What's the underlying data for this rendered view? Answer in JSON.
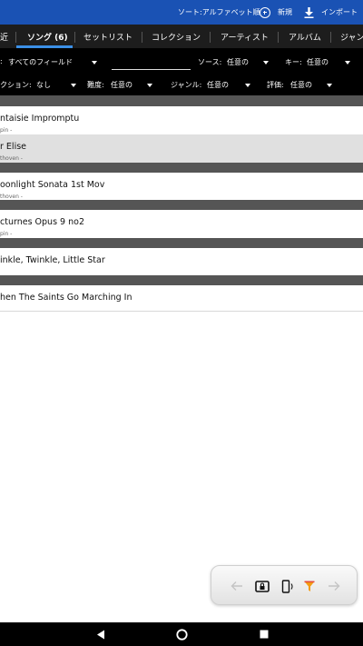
{
  "appbar": {
    "sort_label": "ソート:アルファベット順",
    "new_label": "新規",
    "import_label": "インポート",
    "bg_color": "#1a52b4"
  },
  "tabs": [
    {
      "label": "最近",
      "visible_text": "近",
      "active": false
    },
    {
      "label": "ソング (6)",
      "active": true
    },
    {
      "label": "セットリスト",
      "active": false
    },
    {
      "label": "コレクション",
      "active": false
    },
    {
      "label": "アーティスト",
      "active": false
    },
    {
      "label": "アルバム",
      "active": false
    },
    {
      "label": "ジャンル",
      "visible_text": "ジャン",
      "active": false
    }
  ],
  "filters": {
    "field_label": "すべてのフィールド",
    "field_prefix": ":",
    "search_value": "",
    "source_label": "ソース:",
    "source_value": "任意の",
    "key_label": "キー:",
    "key_value": "任意の",
    "collection_label": "クション:",
    "collection_value": "なし",
    "difficulty_label": "難度:",
    "difficulty_value": "任意の",
    "genre_label": "ジャンル:",
    "genre_value": "任意の",
    "rating_label": "評価:",
    "rating_value": "任意の"
  },
  "songs": [
    {
      "title": "ntaisie Impromptu",
      "subtitle": "pin -",
      "selected": false
    },
    {
      "title": "r Elise",
      "subtitle": "thoven -",
      "selected": true
    },
    {
      "title": "oonlight Sonata 1st Mov",
      "subtitle": "thoven -",
      "selected": false
    },
    {
      "title": "cturnes Opus 9 no2",
      "subtitle": "pin -",
      "selected": false
    },
    {
      "title": "inkle, Twinkle, Little Star",
      "subtitle": "",
      "selected": false
    },
    {
      "title": "hen The Saints Go Marching In",
      "subtitle": "",
      "selected": false
    }
  ],
  "floating_toolbar": {
    "buttons": [
      "back-arrow-icon",
      "screen-lock-icon",
      "phone-rotate-icon",
      "filter-funnel-icon",
      "forward-arrow-icon"
    ],
    "accent_color": "#f39c12"
  },
  "navbar": {
    "buttons": [
      "back-triangle-icon",
      "home-circle-icon",
      "recents-square-icon"
    ]
  }
}
